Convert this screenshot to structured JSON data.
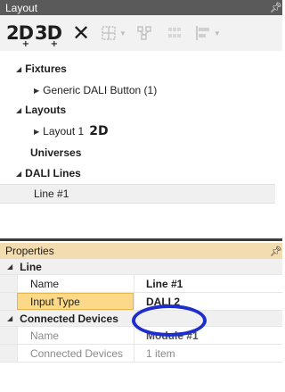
{
  "layout_panel": {
    "title": "Layout",
    "pin_icon": "pin-icon",
    "toolbar": {
      "btn_2d_label": "2D",
      "btn_3d_label": "3D",
      "plus_glyph": "+",
      "delete_glyph": "✕"
    },
    "tree": {
      "fixtures": "Fixtures",
      "fixture_item": "Generic DALI Button (1)",
      "layouts": "Layouts",
      "layout_item": "Layout 1",
      "layout_badge": "2D",
      "universes": "Universes",
      "dali_lines": "DALI Lines",
      "line_item": "Line #1"
    }
  },
  "properties_panel": {
    "title": "Properties",
    "line_category": "Line",
    "line_rows": [
      {
        "name": "Name",
        "value": "Line #1"
      },
      {
        "name": "Input Type",
        "value": "DALI 2"
      }
    ],
    "devices_category": "Connected Devices",
    "device_rows": [
      {
        "name": "Name",
        "value": "Module #1"
      },
      {
        "name": "Connected Devices",
        "value": "1 item"
      }
    ]
  },
  "colors": {
    "layout_header": "#5a5a5a",
    "properties_header": "#f2dcb0",
    "highlight": "#fbd989",
    "annotation_ellipse": "#1d2ecc"
  }
}
